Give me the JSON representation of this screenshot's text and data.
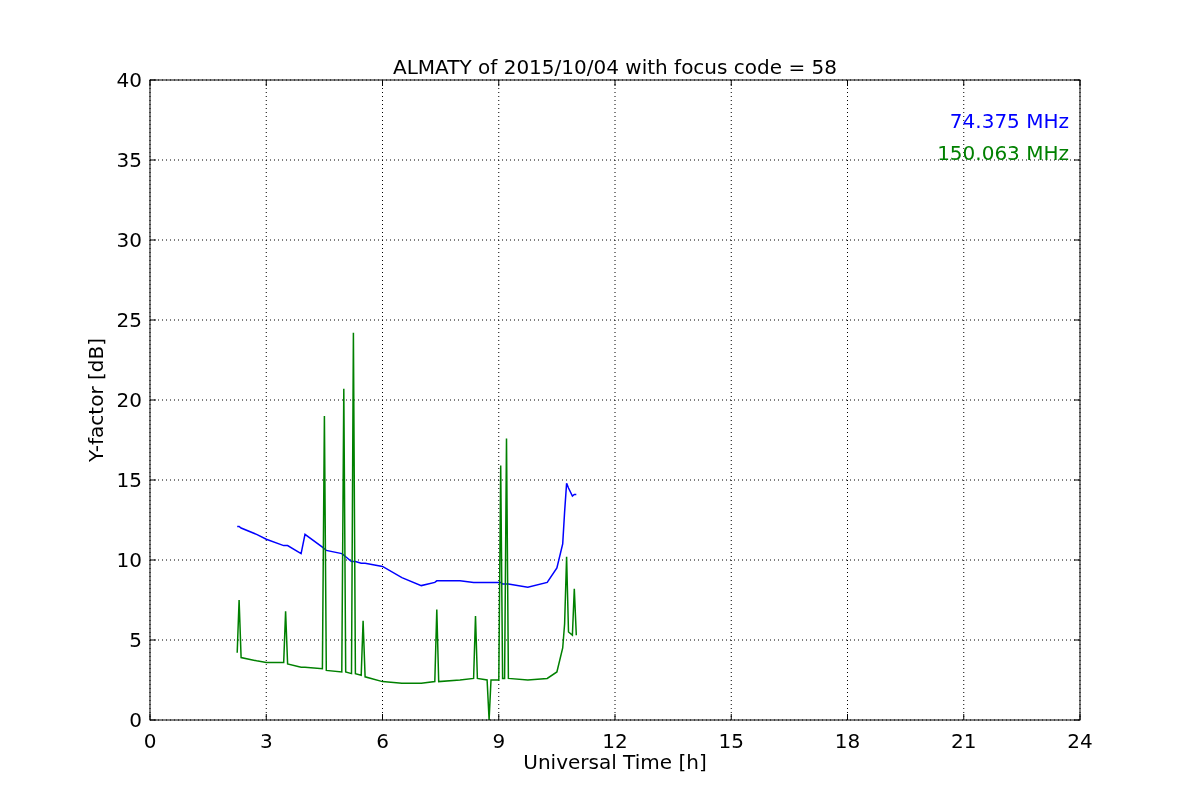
{
  "figure": {
    "chart_data": {
      "type": "line",
      "title": "ALMATY of 2015/10/04 with focus code = 58",
      "xlabel": "Universal Time [h]",
      "ylabel": "Y-factor [dB]",
      "x": [
        2.25,
        2.3,
        2.35,
        2.75,
        3.0,
        3.45,
        3.5,
        3.55,
        3.9,
        4.0,
        4.45,
        4.5,
        4.55,
        4.95,
        5.0,
        5.05,
        5.2,
        5.25,
        5.3,
        5.45,
        5.5,
        5.55,
        6.0,
        6.5,
        7.0,
        7.35,
        7.4,
        7.45,
        8.0,
        8.35,
        8.4,
        8.45,
        8.7,
        8.75,
        8.8,
        9.0,
        9.05,
        9.1,
        9.15,
        9.2,
        9.25,
        9.75,
        10.25,
        10.5,
        10.65,
        10.7,
        10.75,
        10.8,
        10.9,
        10.95,
        11.0
      ],
      "series": [
        {
          "name": "74.375 MHz",
          "color": "#0000ff",
          "values": [
            12.1,
            12.1,
            12.0,
            11.6,
            11.3,
            10.9,
            10.9,
            10.9,
            10.4,
            11.6,
            10.8,
            10.7,
            10.6,
            10.4,
            10.3,
            10.2,
            9.9,
            9.9,
            9.9,
            9.8,
            9.8,
            9.8,
            9.6,
            8.9,
            8.4,
            8.6,
            8.7,
            8.7,
            8.7,
            8.6,
            8.6,
            8.6,
            8.6,
            8.6,
            8.6,
            8.6,
            8.6,
            8.5,
            8.5,
            8.5,
            8.5,
            8.3,
            8.6,
            9.5,
            11.0,
            13.0,
            14.8,
            14.5,
            14.0,
            14.1,
            14.1
          ]
        },
        {
          "name": "150.063 MHz",
          "color": "#008000",
          "values": [
            4.2,
            7.5,
            3.9,
            3.7,
            3.6,
            3.6,
            6.8,
            3.5,
            3.3,
            3.3,
            3.2,
            19.0,
            3.1,
            3.0,
            20.7,
            3.0,
            2.9,
            24.2,
            2.9,
            2.8,
            6.2,
            2.7,
            2.4,
            2.3,
            2.3,
            2.4,
            6.9,
            2.4,
            2.5,
            2.6,
            6.5,
            2.6,
            2.5,
            0,
            2.5,
            2.5,
            15.9,
            2.6,
            2.6,
            17.6,
            2.6,
            2.5,
            2.6,
            3.0,
            4.5,
            6.0,
            10.2,
            5.5,
            5.3,
            8.2,
            5.3
          ]
        }
      ],
      "grid": true,
      "xlim": [
        0,
        24
      ],
      "ylim": [
        0,
        40
      ],
      "xticks": [
        0,
        3,
        6,
        9,
        12,
        15,
        18,
        21,
        24
      ],
      "yticks": [
        0,
        5,
        10,
        15,
        20,
        25,
        30,
        35,
        40
      ]
    }
  }
}
